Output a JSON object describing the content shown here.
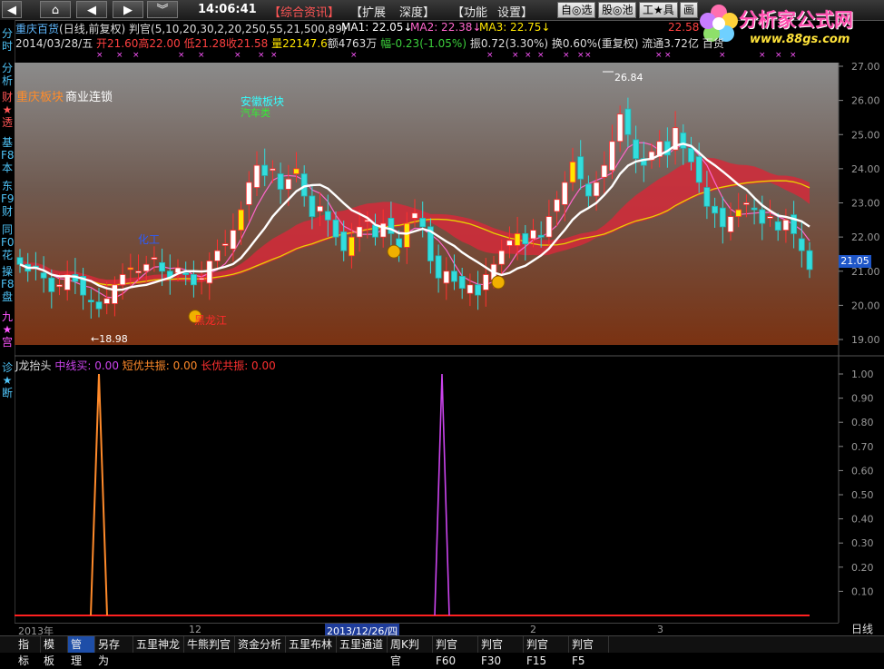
{
  "toolbar": {
    "time": "14:06:41",
    "news_label": "【综合资讯】",
    "menus": [
      "【扩展",
      "深度】",
      "【功能",
      "设置】"
    ],
    "select_buttons": [
      "自◎选",
      "股◎池",
      "工★具",
      "画"
    ],
    "logo_text": "分析家公式网",
    "logo_url": "www.88gs.com"
  },
  "left_tabs": [
    {
      "label": "分时",
      "color": "#4fc3f7"
    },
    {
      "label": "分析",
      "color": "#4fc3f7"
    },
    {
      "label": "财★透",
      "color": "#ff5555"
    },
    {
      "label": "基F8本",
      "color": "#4fc3f7"
    },
    {
      "label": "东F9财",
      "color": "#4fc3f7"
    },
    {
      "label": "同F0花",
      "color": "#4fc3f7"
    },
    {
      "label": "操F8盘",
      "color": "#4fc3f7"
    },
    {
      "label": "九★宫",
      "color": "#ff55ff"
    },
    {
      "label": "诊★断",
      "color": "#4fc3f7"
    }
  ],
  "header": {
    "stock_name": "重庆百货",
    "period": "(日线,前复权)",
    "indicator": "判官(5,10,20,30,2,20,250,55,21,500,89)",
    "ma1": "MA1: 22.05↓",
    "ma2": "MA2: 22.38↓",
    "ma3": "MA3: 22.75↓",
    "extra_value": "22.58"
  },
  "quote_line": {
    "date": "2014/03/28/五",
    "open": "开21.60",
    "high": "高22.00",
    "low": "低21.28",
    "close": "收21.58",
    "volume": "量22147.6",
    "amount": "额4763万",
    "change": "幅-0.23(-1.05%)",
    "amplitude": "振0.72(3.30%)",
    "turnover": "换0.60%(重复权)",
    "float": "流通3.72亿",
    "sector": "百货"
  },
  "price_panel": {
    "sector_tags": [
      "重庆板块",
      "商业连锁"
    ],
    "annotations": [
      "安徽板块",
      "汽车类",
      "化工",
      "黑龙江"
    ],
    "high_label": "26.84",
    "low_label": "←18.98",
    "current_price": "21.05"
  },
  "y_axis_price": [
    "27.00",
    "26.00",
    "25.00",
    "24.00",
    "23.00",
    "22.00",
    "21.00",
    "20.00",
    "19.00"
  ],
  "indicator_panel": {
    "name": "J龙抬头",
    "line1": "中线买: 0.00",
    "line2": "短优共振: 0.00",
    "line3": "长优共振: 0.00"
  },
  "y_axis_ind": [
    "1.00",
    "0.90",
    "0.80",
    "0.70",
    "0.60",
    "0.50",
    "0.40",
    "0.30",
    "0.20",
    "0.10"
  ],
  "date_axis": {
    "labels": [
      "2013年",
      "12",
      "2013/12/26/四",
      "2",
      "3"
    ],
    "period_button": "日线"
  },
  "bottom_tabs": [
    "指标",
    "模板",
    "管理",
    "另存为",
    "五里神龙",
    "牛熊判官",
    "资金分析",
    "五里布林",
    "五里通道",
    "周K判官",
    "判官F60",
    "判官F30",
    "判官F15",
    "判官F5"
  ],
  "colors": {
    "price_bg_top": "#8a8a8a",
    "price_bg_bottom": "#7a3414",
    "up_candle": "#ffffff",
    "down_candle": "#33dddd",
    "ma_white": "#ffffff",
    "ma_yellow": "#e8d200",
    "ma_pink": "#ff66cc",
    "band_red": "#d42a3a",
    "ind_orange": "#ff8a2a",
    "ind_purple": "#cc44ee",
    "baseline_red": "#ff2020"
  }
}
